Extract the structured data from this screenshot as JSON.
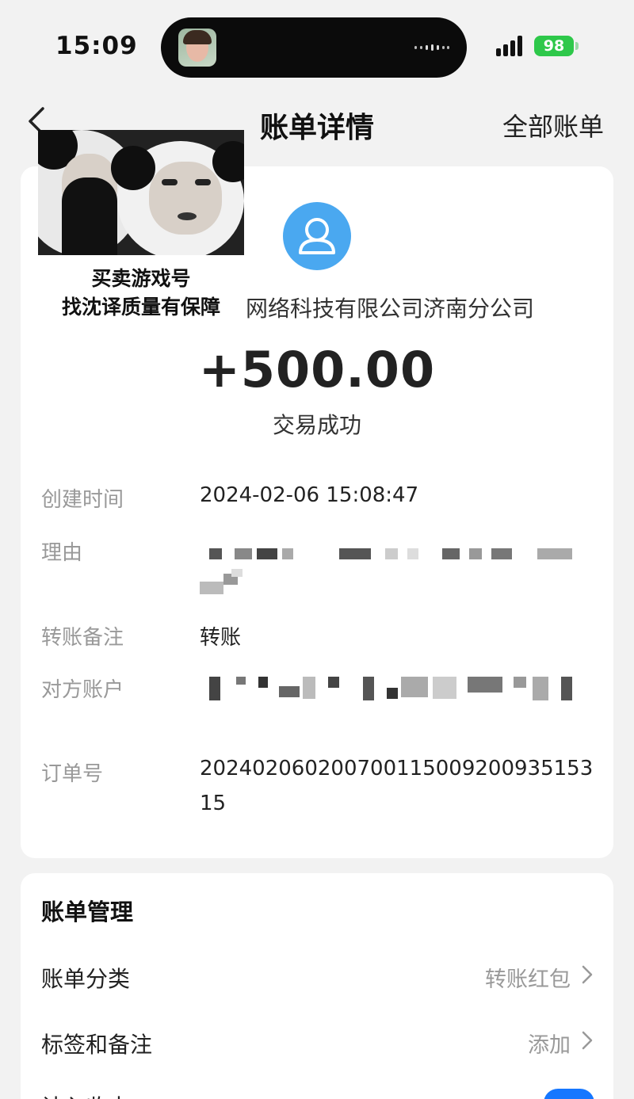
{
  "status_bar": {
    "time": "15:09",
    "battery": "98"
  },
  "nav": {
    "title": "账单详情",
    "right_link": "全部账单"
  },
  "meme": {
    "line1": "买卖游戏号",
    "line2": "找沈译质量有保障"
  },
  "payee": {
    "name": "网络科技有限公司济南分公司"
  },
  "transaction": {
    "amount": "+500.00",
    "status": "交易成功"
  },
  "details": {
    "created_label": "创建时间",
    "created_value": "2024-02-06 15:08:47",
    "reason_label": "理由",
    "remark_label": "转账备注",
    "remark_value": "转账",
    "account_label": "对方账户",
    "order_label": "订单号",
    "order_value": "20240206020070011500920093515315"
  },
  "manage": {
    "title": "账单管理",
    "category_label": "账单分类",
    "category_value": "转账红包",
    "tags_label": "标签和备注",
    "tags_value": "添加",
    "stats_label": "计入收支"
  },
  "colors": {
    "accent": "#1677ff",
    "avatar": "#4aa8f0",
    "battery": "#2ec84a"
  },
  "icons": [
    "back-arrow-icon",
    "user-avatar-icon",
    "chevron-right-icon",
    "signal-icon",
    "battery-icon"
  ]
}
